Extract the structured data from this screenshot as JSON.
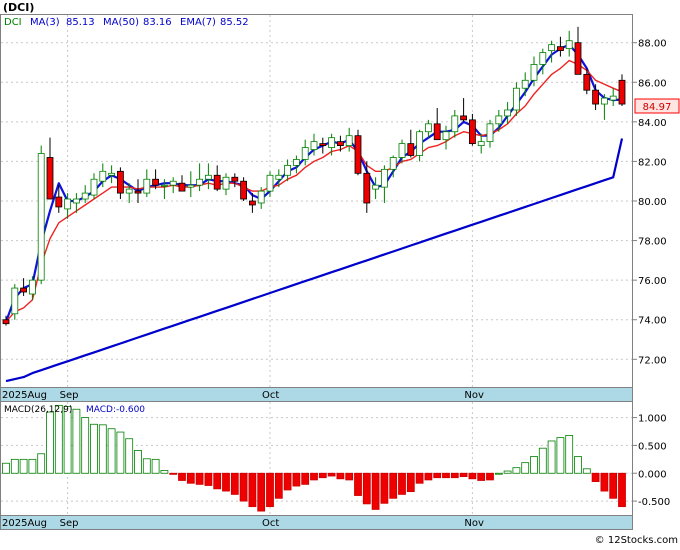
{
  "chart_data": [
    {
      "type": "candlestick",
      "title": "(DCI)",
      "legend": [
        {
          "name": "DCI",
          "color": "#008000"
        },
        {
          "name": "MA(3)",
          "value": "85.13",
          "color": "#0000cc"
        },
        {
          "name": "MA(50)",
          "value": "83.16",
          "color": "#0000cc"
        },
        {
          "name": "EMA(7)",
          "value": "85.52",
          "color": "#0000cc"
        }
      ],
      "last_price": "84.97",
      "ylim": [
        70.6,
        89.4
      ],
      "yticks": [
        "72.00",
        "74.00",
        "76.00",
        "78.00",
        "80.00",
        "82.00",
        "84.00",
        "86.00",
        "88.00"
      ],
      "xticks": [
        {
          "label": "2025Aug",
          "index": 0
        },
        {
          "label": "Sep",
          "index": 7
        },
        {
          "label": "Oct",
          "index": 30
        },
        {
          "label": "Nov",
          "index": 53
        }
      ],
      "series": [
        {
          "name": "DCI",
          "ohlc": [
            [
              74.0,
              74.2,
              73.7,
              73.8
            ],
            [
              74.3,
              75.8,
              74.0,
              75.6
            ],
            [
              75.6,
              76.1,
              75.2,
              75.4
            ],
            [
              75.3,
              76.2,
              75.0,
              76.0
            ],
            [
              76.0,
              82.8,
              75.8,
              82.4
            ],
            [
              82.2,
              83.2,
              81.4,
              80.1
            ],
            [
              80.2,
              80.8,
              79.4,
              79.7
            ],
            [
              79.6,
              80.4,
              79.1,
              80.1
            ],
            [
              79.9,
              80.4,
              79.4,
              80.1
            ],
            [
              80.1,
              80.8,
              79.9,
              80.4
            ],
            [
              80.3,
              81.4,
              80.1,
              81.1
            ],
            [
              81.0,
              81.9,
              80.7,
              81.5
            ],
            [
              81.3,
              81.8,
              80.9,
              81.4
            ],
            [
              81.5,
              81.7,
              80.1,
              80.4
            ],
            [
              80.4,
              80.9,
              79.9,
              80.6
            ],
            [
              80.5,
              81.1,
              79.9,
              80.4
            ],
            [
              80.4,
              81.6,
              80.2,
              81.1
            ],
            [
              81.1,
              81.6,
              80.6,
              80.8
            ],
            [
              80.8,
              81.1,
              80.1,
              80.8
            ],
            [
              80.8,
              81.2,
              80.4,
              81.0
            ],
            [
              80.9,
              81.3,
              80.5,
              80.5
            ],
            [
              80.7,
              81.5,
              80.2,
              80.8
            ],
            [
              80.8,
              81.9,
              80.5,
              81.1
            ],
            [
              81.1,
              81.9,
              80.6,
              81.3
            ],
            [
              81.3,
              81.8,
              80.5,
              80.6
            ],
            [
              80.6,
              81.4,
              80.3,
              81.2
            ],
            [
              81.2,
              81.4,
              80.7,
              81.0
            ],
            [
              81.0,
              81.2,
              80.0,
              80.1
            ],
            [
              80.0,
              80.4,
              79.4,
              79.8
            ],
            [
              79.9,
              80.7,
              79.6,
              80.5
            ],
            [
              80.5,
              81.5,
              80.2,
              81.3
            ],
            [
              81.1,
              81.6,
              80.7,
              81.3
            ],
            [
              81.3,
              82.1,
              81.0,
              81.8
            ],
            [
              81.8,
              82.3,
              81.4,
              82.1
            ],
            [
              82.1,
              83.1,
              81.8,
              82.7
            ],
            [
              82.6,
              83.4,
              82.3,
              83.0
            ],
            [
              82.9,
              83.2,
              82.4,
              82.8
            ],
            [
              82.7,
              83.4,
              82.3,
              83.2
            ],
            [
              83.0,
              83.3,
              82.5,
              82.8
            ],
            [
              82.8,
              83.7,
              82.5,
              83.3
            ],
            [
              83.3,
              83.6,
              81.3,
              81.4
            ],
            [
              81.4,
              82.0,
              79.4,
              79.9
            ],
            [
              80.6,
              81.2,
              80.1,
              80.8
            ],
            [
              80.7,
              81.8,
              79.9,
              81.6
            ],
            [
              81.6,
              82.3,
              81.2,
              82.2
            ],
            [
              82.2,
              83.1,
              81.9,
              82.9
            ],
            [
              82.9,
              83.6,
              82.2,
              82.3
            ],
            [
              82.3,
              83.6,
              82.0,
              83.5
            ],
            [
              83.5,
              84.1,
              83.2,
              83.9
            ],
            [
              83.9,
              84.7,
              83.3,
              83.1
            ],
            [
              83.1,
              83.8,
              82.6,
              83.5
            ],
            [
              83.5,
              84.6,
              83.2,
              84.3
            ],
            [
              84.3,
              85.2,
              84.0,
              84.1
            ],
            [
              84.1,
              84.4,
              82.8,
              82.9
            ],
            [
              82.8,
              83.4,
              82.4,
              83.0
            ],
            [
              83.0,
              84.1,
              82.7,
              83.9
            ],
            [
              83.9,
              84.6,
              83.5,
              84.3
            ],
            [
              84.3,
              85.0,
              83.9,
              84.6
            ],
            [
              84.6,
              86.0,
              84.3,
              85.7
            ],
            [
              85.7,
              86.5,
              85.3,
              86.1
            ],
            [
              86.1,
              87.3,
              85.8,
              86.9
            ],
            [
              86.9,
              87.7,
              86.4,
              87.5
            ],
            [
              87.6,
              88.1,
              87.0,
              87.9
            ],
            [
              87.8,
              88.3,
              87.3,
              87.6
            ],
            [
              87.7,
              88.6,
              87.3,
              88.1
            ],
            [
              88.0,
              88.8,
              86.7,
              86.4
            ],
            [
              86.4,
              86.7,
              85.4,
              85.6
            ],
            [
              85.6,
              85.9,
              84.6,
              84.9
            ],
            [
              84.9,
              85.4,
              84.1,
              85.2
            ],
            [
              85.1,
              85.7,
              84.8,
              85.3
            ],
            [
              86.1,
              86.4,
              84.8,
              84.9
            ]
          ]
        },
        {
          "name": "MA(3)",
          "values": [
            73.9,
            75.1,
            75.6,
            75.8,
            77.9,
            79.5,
            80.9,
            80.0,
            80.0,
            80.2,
            80.5,
            81.0,
            81.3,
            81.1,
            80.8,
            80.5,
            80.7,
            80.8,
            80.9,
            80.9,
            80.8,
            80.8,
            80.8,
            81.1,
            81.0,
            81.0,
            80.9,
            80.8,
            80.3,
            80.1,
            80.5,
            81.0,
            81.5,
            81.7,
            82.2,
            82.6,
            82.8,
            83.0,
            82.9,
            83.1,
            82.5,
            81.5,
            80.7,
            80.8,
            81.5,
            82.2,
            82.5,
            82.9,
            83.2,
            83.5,
            83.5,
            83.6,
            84.0,
            83.8,
            83.3,
            83.3,
            83.7,
            84.3,
            84.9,
            85.5,
            86.2,
            86.8,
            87.4,
            87.7,
            87.9,
            87.4,
            86.7,
            85.6,
            85.2,
            85.1,
            85.13
          ]
        },
        {
          "name": "MA(50)",
          "values": [
            70.9,
            71.0,
            71.1,
            71.3,
            71.45,
            71.6,
            71.75,
            71.9,
            72.05,
            72.2,
            72.35,
            72.5,
            72.65,
            72.8,
            72.95,
            73.1,
            73.25,
            73.4,
            73.55,
            73.7,
            73.85,
            74.0,
            74.15,
            74.3,
            74.45,
            74.6,
            74.75,
            74.9,
            75.05,
            75.2,
            75.35,
            75.5,
            75.65,
            75.8,
            75.95,
            76.1,
            76.25,
            76.4,
            76.55,
            76.7,
            76.85,
            77.0,
            77.15,
            77.3,
            77.45,
            77.6,
            77.75,
            77.9,
            78.05,
            78.2,
            78.35,
            78.5,
            78.65,
            78.8,
            78.95,
            79.1,
            79.25,
            79.4,
            79.55,
            79.7,
            79.85,
            80.0,
            80.15,
            80.3,
            80.45,
            80.6,
            80.75,
            80.9,
            81.05,
            81.2,
            83.16
          ]
        },
        {
          "name": "EMA(7)",
          "values": [
            73.9,
            74.4,
            74.6,
            75.0,
            76.8,
            78.1,
            78.9,
            79.2,
            79.5,
            79.8,
            80.1,
            80.4,
            80.7,
            80.7,
            80.7,
            80.6,
            80.7,
            80.7,
            80.7,
            80.8,
            80.7,
            80.7,
            80.8,
            80.9,
            80.8,
            80.9,
            80.9,
            80.7,
            80.5,
            80.5,
            80.7,
            80.8,
            81.1,
            81.3,
            81.7,
            82.0,
            82.2,
            82.5,
            82.6,
            82.8,
            82.5,
            81.8,
            81.5,
            81.5,
            81.7,
            82.0,
            82.1,
            82.4,
            82.7,
            82.8,
            83.0,
            83.3,
            83.5,
            83.4,
            83.3,
            83.4,
            83.6,
            83.9,
            84.4,
            84.8,
            85.4,
            85.9,
            86.4,
            86.7,
            87.1,
            86.9,
            86.6,
            86.1,
            85.9,
            85.7,
            85.52
          ]
        }
      ]
    },
    {
      "type": "bar",
      "title": "MACD(26,12,9)",
      "legend": [
        {
          "name": "MACD:-0.600",
          "color": "#0000cc"
        }
      ],
      "ylim": [
        -0.75,
        1.28
      ],
      "yticks": [
        "1.000",
        "0.500",
        "0.000",
        "-0.500"
      ],
      "xticks": [
        {
          "label": "2025Aug",
          "index": 0
        },
        {
          "label": "Sep",
          "index": 7
        },
        {
          "label": "Oct",
          "index": 30
        },
        {
          "label": "Nov",
          "index": 53
        }
      ],
      "series": [
        {
          "name": "MACD",
          "values": [
            0.18,
            0.25,
            0.25,
            0.25,
            0.35,
            1.1,
            1.22,
            1.2,
            1.15,
            1.0,
            0.88,
            0.87,
            0.8,
            0.74,
            0.62,
            0.41,
            0.26,
            0.25,
            0.05,
            -0.02,
            -0.13,
            -0.18,
            -0.2,
            -0.22,
            -0.28,
            -0.32,
            -0.38,
            -0.5,
            -0.6,
            -0.68,
            -0.6,
            -0.45,
            -0.3,
            -0.23,
            -0.2,
            -0.12,
            -0.08,
            -0.05,
            -0.1,
            -0.12,
            -0.4,
            -0.55,
            -0.65,
            -0.54,
            -0.45,
            -0.38,
            -0.33,
            -0.18,
            -0.12,
            -0.08,
            -0.08,
            -0.08,
            -0.06,
            -0.1,
            -0.13,
            -0.12,
            0.0,
            0.04,
            0.1,
            0.19,
            0.3,
            0.45,
            0.58,
            0.64,
            0.68,
            0.3,
            0.08,
            -0.15,
            -0.32,
            -0.45,
            -0.6
          ]
        }
      ]
    }
  ],
  "watermark": "© 12Stocks.com"
}
